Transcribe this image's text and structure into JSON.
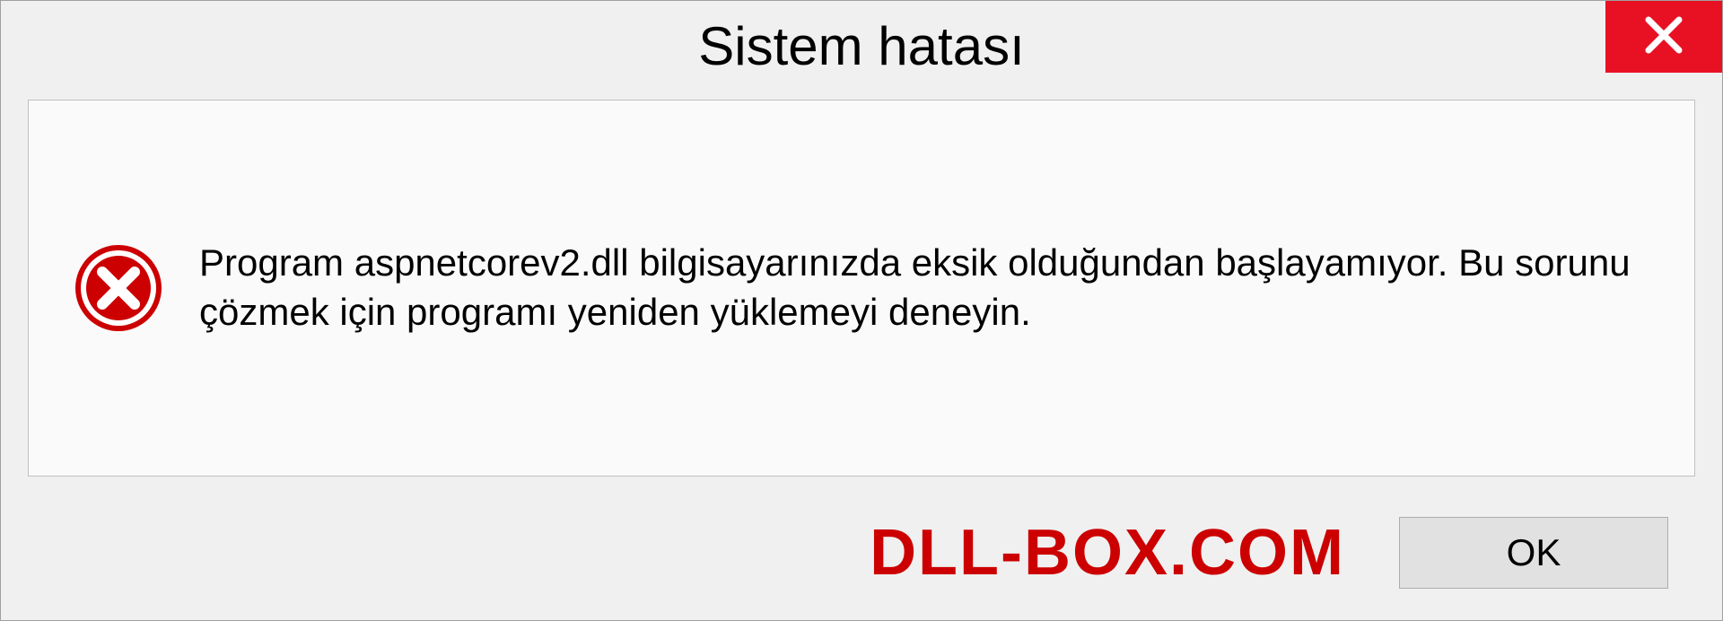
{
  "title": "Sistem hatası",
  "message": "Program aspnetcorev2.dll bilgisayarınızda eksik olduğundan başlayamıyor. Bu sorunu çözmek için programı yeniden yüklemeyi deneyin.",
  "ok_label": "OK",
  "watermark": "DLL-BOX.COM",
  "colors": {
    "close_bg": "#e81123",
    "error_red": "#cc0000",
    "watermark_red": "#cc0000"
  }
}
